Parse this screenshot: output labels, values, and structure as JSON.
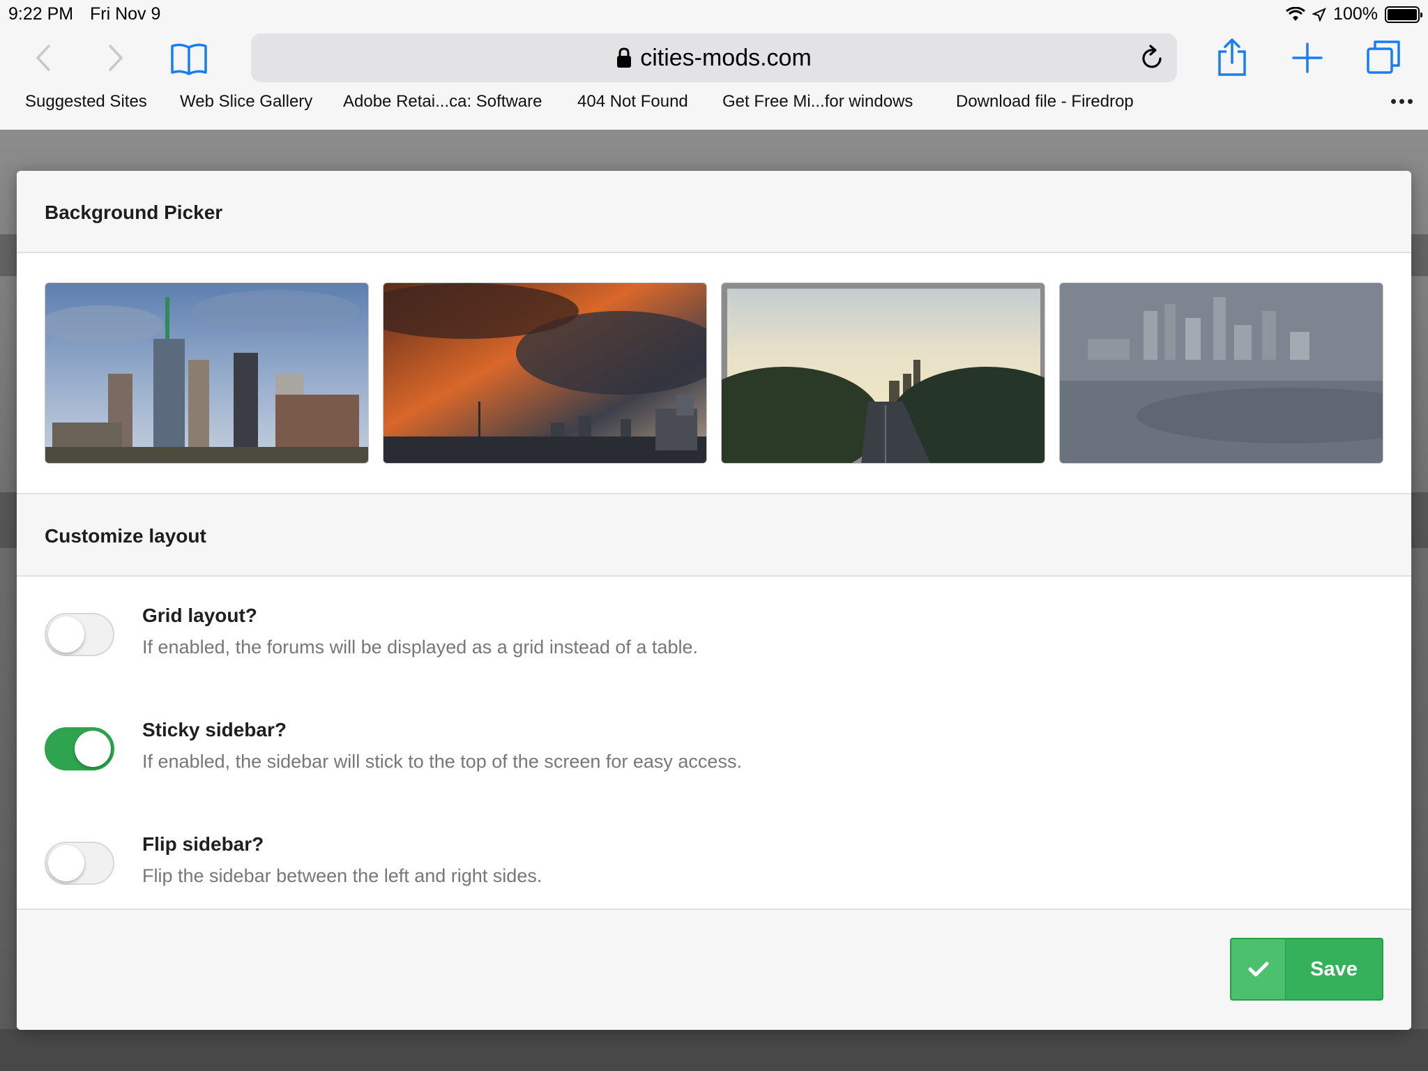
{
  "status_bar": {
    "time": "9:22 PM",
    "date": "Fri Nov 9",
    "battery": "100%"
  },
  "browser": {
    "url": "cities-mods.com",
    "bookmarks": [
      "Suggested Sites",
      "Web Slice Gallery",
      "Adobe Retai...ca: Software",
      "404 Not Found",
      "Get Free Mi...for windows",
      "Download file - Firedrop"
    ],
    "colors": {
      "icon_blue": "#1a7cf3",
      "disabled": "#c7c7cc"
    }
  },
  "modal": {
    "background_picker": {
      "title": "Background Picker",
      "thumbnails": [
        "city-skyline-day",
        "city-sunset-storm",
        "highway-skyline",
        "aerial-city-grayscale"
      ]
    },
    "customize_layout": {
      "title": "Customize layout",
      "options": [
        {
          "title": "Grid layout?",
          "description": "If enabled, the forums will be displayed as a grid instead of a table.",
          "enabled": false
        },
        {
          "title": "Sticky sidebar?",
          "description": "If enabled, the sidebar will stick to the top of the screen for easy access.",
          "enabled": true
        },
        {
          "title": "Flip sidebar?",
          "description": "Flip the sidebar between the left and right sides.",
          "enabled": false
        }
      ]
    },
    "save_label": "Save",
    "colors": {
      "accent_green": "#34b15a",
      "toggle_on": "#2ea44f"
    }
  }
}
